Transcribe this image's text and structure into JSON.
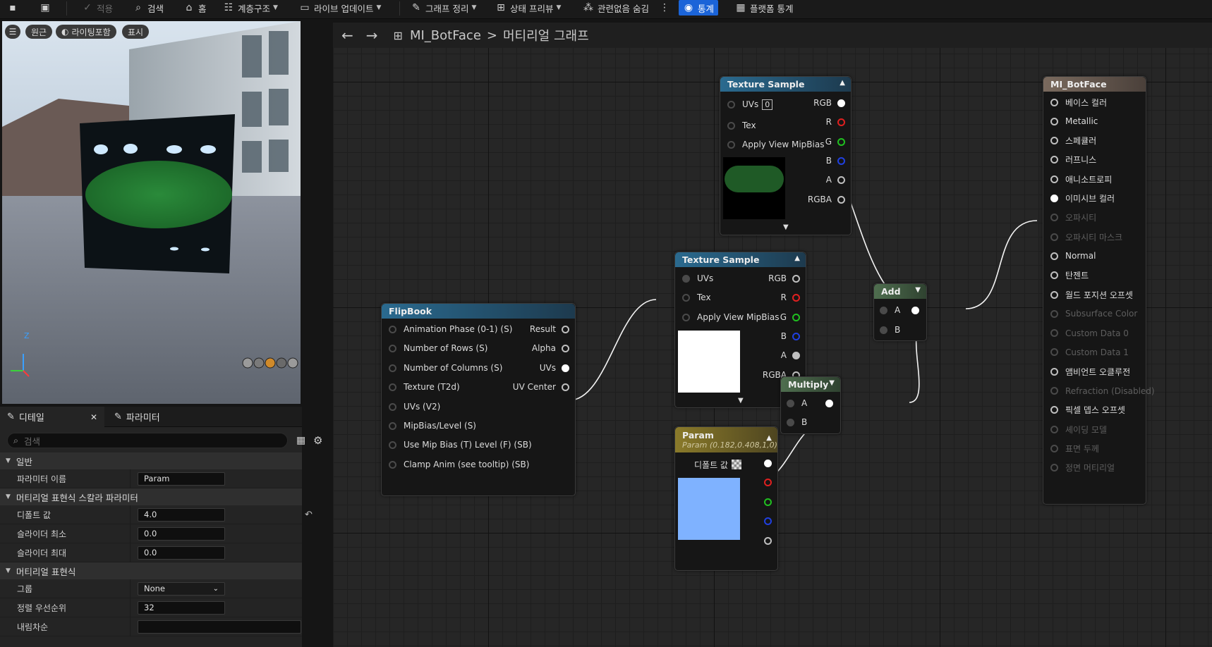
{
  "toolbar": {
    "items": [
      "적용",
      "검색",
      "홈",
      "계층구조",
      "라이브 업데이트",
      "그래프 정리",
      "상태 프리뷰",
      "관련없음 숨김",
      "통계",
      "플랫폼 통계"
    ]
  },
  "viewport": {
    "buttons": [
      "원근",
      "라이팅포함",
      "표시"
    ],
    "axis": {
      "z": "Z"
    }
  },
  "details": {
    "tabs": [
      "디테일",
      "파라미터"
    ],
    "search_placeholder": "검색",
    "sections": [
      "일반",
      "머티리얼 표현식 스칼라 파라미터",
      "머티리얼 표현식"
    ],
    "rows": [
      {
        "label": "파라미터 이름",
        "value": "Param"
      },
      {
        "label": "디폴트 값",
        "value": "4.0"
      },
      {
        "label": "슬라이더 최소",
        "value": "0.0"
      },
      {
        "label": "슬라이더 최대",
        "value": "0.0"
      },
      {
        "label": "그룹",
        "value": "None"
      },
      {
        "label": "정렬 우선순위",
        "value": "32"
      },
      {
        "label": "내림차순",
        "value": ""
      }
    ]
  },
  "graph": {
    "breadcrumb": {
      "asset": "MI_BotFace",
      "separator": ">",
      "current": "머티리얼 그래프"
    },
    "nodes": {
      "ts1": {
        "title": "Texture Sample",
        "uv_label": "UVs",
        "uv_index": "0",
        "inputs": [
          "Tex",
          "Apply View MipBias"
        ],
        "outputs": [
          "RGB",
          "R",
          "G",
          "B",
          "A",
          "RGBA"
        ]
      },
      "ts2": {
        "title": "Texture Sample",
        "inputs": [
          "UVs",
          "Tex",
          "Apply View MipBias"
        ],
        "outputs": [
          "RGB",
          "R",
          "G",
          "B",
          "A",
          "RGBA"
        ]
      },
      "flipbook": {
        "title": "FlipBook",
        "inputs": [
          "Animation  Phase (0-1) (S)",
          "Number of Rows (S)",
          "Number of Columns (S)",
          "Texture (T2d)",
          "UVs (V2)",
          "MipBias/Level (S)",
          "Use Mip Bias (T) Level (F) (SB)",
          "Clamp Anim (see tooltip) (SB)"
        ],
        "outputs": [
          "Result",
          "Alpha",
          "UVs",
          "UV Center"
        ]
      },
      "param": {
        "title": "Param",
        "subtitle": "Param (0.182,0.408,1,0)",
        "default_label": "디폴트 값",
        "color": "#7fb2ff"
      },
      "add": {
        "title": "Add",
        "inputs": [
          "A",
          "B"
        ]
      },
      "multiply": {
        "title": "Multiply",
        "inputs": [
          "A",
          "B"
        ]
      },
      "result": {
        "title": "MI_BotFace",
        "pins": [
          {
            "label": "베이스 컬러",
            "active": true
          },
          {
            "label": "Metallic",
            "active": true
          },
          {
            "label": "스페큘러",
            "active": true
          },
          {
            "label": "러프니스",
            "active": true
          },
          {
            "label": "애니소트로피",
            "active": true
          },
          {
            "label": "이미시브 컬러",
            "active": true,
            "connected": true
          },
          {
            "label": "오파시티",
            "active": false
          },
          {
            "label": "오파시티 마스크",
            "active": false
          },
          {
            "label": "Normal",
            "active": true
          },
          {
            "label": "탄젠트",
            "active": true
          },
          {
            "label": "월드 포지션 오프셋",
            "active": true
          },
          {
            "label": "Subsurface Color",
            "active": false
          },
          {
            "label": "Custom Data 0",
            "active": false
          },
          {
            "label": "Custom Data 1",
            "active": false
          },
          {
            "label": "앰비언트 오클루전",
            "active": true
          },
          {
            "label": "Refraction (Disabled)",
            "active": false
          },
          {
            "label": "픽셀 뎁스 오프셋",
            "active": true
          },
          {
            "label": "셰이딩 모델",
            "active": false
          },
          {
            "label": "표면 두께",
            "active": false
          },
          {
            "label": "정면 머티리얼",
            "active": false
          }
        ]
      }
    }
  },
  "colors": {
    "accent": "#1b64d8",
    "texture_header": "#2a6a8f",
    "math_header": "#4f6e4f",
    "param_header": "#8a7a2a",
    "result_header": "#7a6a5e"
  }
}
